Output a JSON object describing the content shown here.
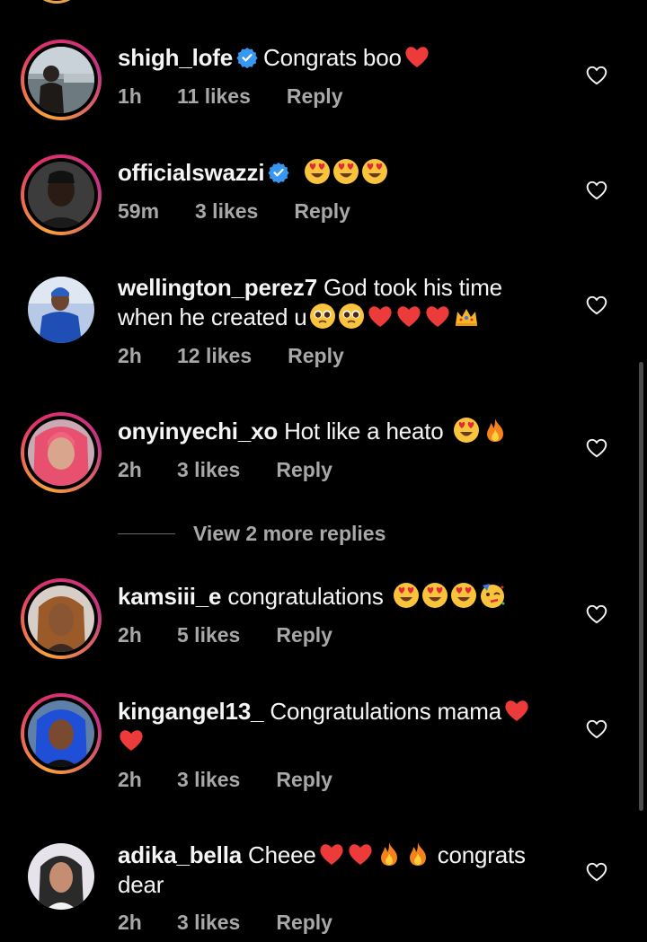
{
  "colors": {
    "background": "#000000",
    "text_primary": "#f5f5f5",
    "text_secondary": "#a8a8a8",
    "verified_blue": "#3897f0",
    "heart_red": "#ed3b3b",
    "story_ring_start": "#f8a13a",
    "story_ring_end": "#c13584"
  },
  "comments": [
    {
      "username": "shigh_lofe",
      "verified": true,
      "text": "Congrats boo",
      "emojis": [
        "red-heart"
      ],
      "time": "1h",
      "likes": "11 likes",
      "reply": "Reply",
      "story_ring": true
    },
    {
      "username": "officialswazzi",
      "verified": true,
      "text": "",
      "emojis": [
        "heart-eyes",
        "heart-eyes",
        "heart-eyes"
      ],
      "time": "59m",
      "likes": "3 likes",
      "reply": "Reply",
      "story_ring": true
    },
    {
      "username": "wellington_perez7",
      "verified": false,
      "text_line1": "God took his time",
      "text_line2": "when he created u",
      "emojis": [
        "pleading-face",
        "pleading-face",
        "red-heart",
        "red-heart",
        "red-heart",
        "crown"
      ],
      "time": "2h",
      "likes": "12 likes",
      "reply": "Reply",
      "story_ring": false
    },
    {
      "username": "onyinyechi_xo",
      "verified": false,
      "text": "Hot like a heato",
      "emojis": [
        "heart-eyes",
        "fire"
      ],
      "time": "2h",
      "likes": "3 likes",
      "reply": "Reply",
      "story_ring": true
    },
    {
      "username": "kamsiii_e",
      "verified": false,
      "text": "congratulations",
      "emojis": [
        "heart-eyes",
        "heart-eyes",
        "heart-eyes",
        "partying-face"
      ],
      "time": "2h",
      "likes": "5 likes",
      "reply": "Reply",
      "story_ring": true
    },
    {
      "username": "kingangel13_",
      "verified": false,
      "text": "Congratulations mama",
      "emojis": [
        "red-heart",
        "red-heart"
      ],
      "time": "2h",
      "likes": "3 likes",
      "reply": "Reply",
      "story_ring": true
    },
    {
      "username": "adika_bella",
      "verified": false,
      "text_part1": "Cheee",
      "text_part2": "congrats",
      "text_part3": "dear",
      "emojis": [
        "red-heart",
        "red-heart",
        "fire",
        "fire"
      ],
      "time": "2h",
      "likes": "3 likes",
      "reply": "Reply",
      "story_ring": false
    }
  ],
  "view_more_replies": "View 2 more replies",
  "icons": {
    "verified": "verified-badge-icon",
    "like": "heart-outline-icon"
  }
}
